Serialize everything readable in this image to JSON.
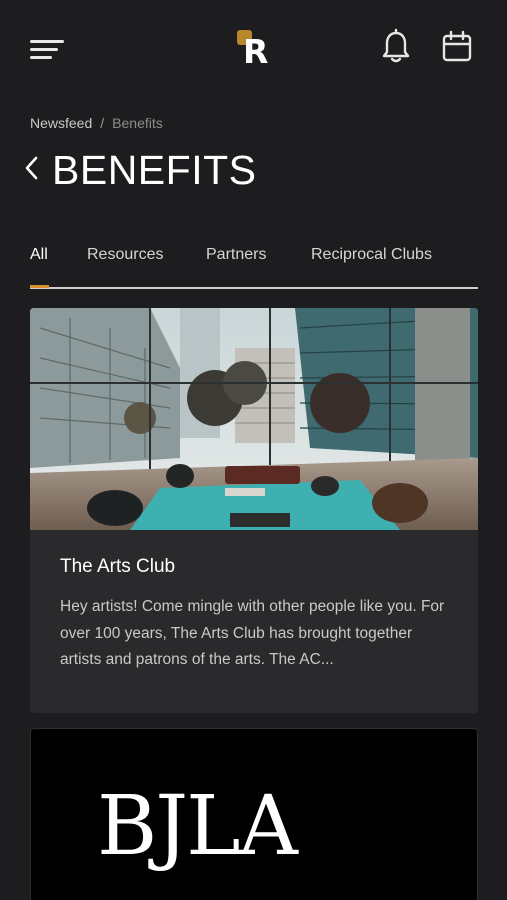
{
  "header": {
    "logo_letter": "R",
    "icons": [
      "menu-icon",
      "bell-icon",
      "calendar-icon"
    ]
  },
  "breadcrumb": {
    "items": [
      "Newsfeed",
      "Benefits"
    ],
    "separator": "/"
  },
  "page": {
    "title": "BENEFITS"
  },
  "tabs": [
    {
      "label": "All",
      "active": true
    },
    {
      "label": "Resources",
      "active": false
    },
    {
      "label": "Partners",
      "active": false
    },
    {
      "label": "Reciprocal Clubs",
      "active": false
    }
  ],
  "cards": [
    {
      "title": "The Arts Club",
      "description": "Hey artists! Come mingle with other people like you. For over 100 years, The Arts Club has brought together artists and patrons of the arts. The AC...",
      "image": "modern lobby with teal rug and lounge chairs"
    },
    {
      "logo_text": "BJLA"
    }
  ],
  "colors": {
    "background": "#1d1d1f",
    "card": "#2a2a2c",
    "accent": "#d9912d",
    "logo_gold": "#b8862b"
  }
}
